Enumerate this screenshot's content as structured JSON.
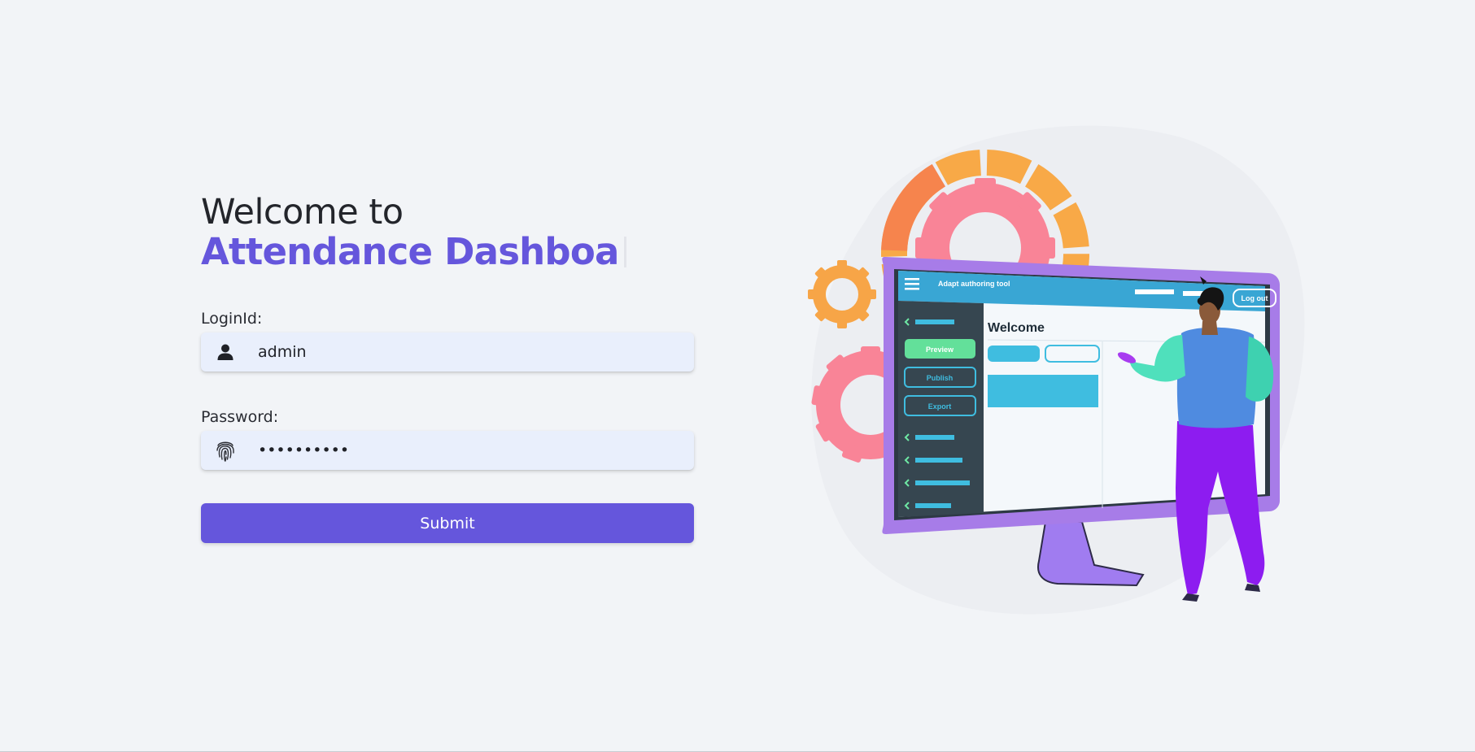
{
  "heading": {
    "line1": "Welcome to",
    "line2": "Attendance Dashboa"
  },
  "login": {
    "label": "LoginId:",
    "value": "admin",
    "icon": "user-icon"
  },
  "password": {
    "label": "Password:",
    "value": "••••••••••",
    "icon": "fingerprint-icon"
  },
  "submit": {
    "label": "Submit"
  },
  "illustration": {
    "app_title": "Adapt authoring tool",
    "logout_label": "Log out",
    "welcome_text": "Welcome",
    "preview_label": "Preview",
    "publish_label": "Publish",
    "export_label": "Export",
    "colors": {
      "accent": "#6556dc",
      "screen_header": "#39a6d4",
      "monitor_frame": "#a77ce8",
      "sidebar": "#364650",
      "gear_pink": "#f98497",
      "gear_orange": "#f7a547",
      "preview_green": "#63e09a",
      "person_shirt": "#4f8be0",
      "person_sleeve": "#4fe0bc",
      "person_pants": "#8d1cf0"
    }
  }
}
